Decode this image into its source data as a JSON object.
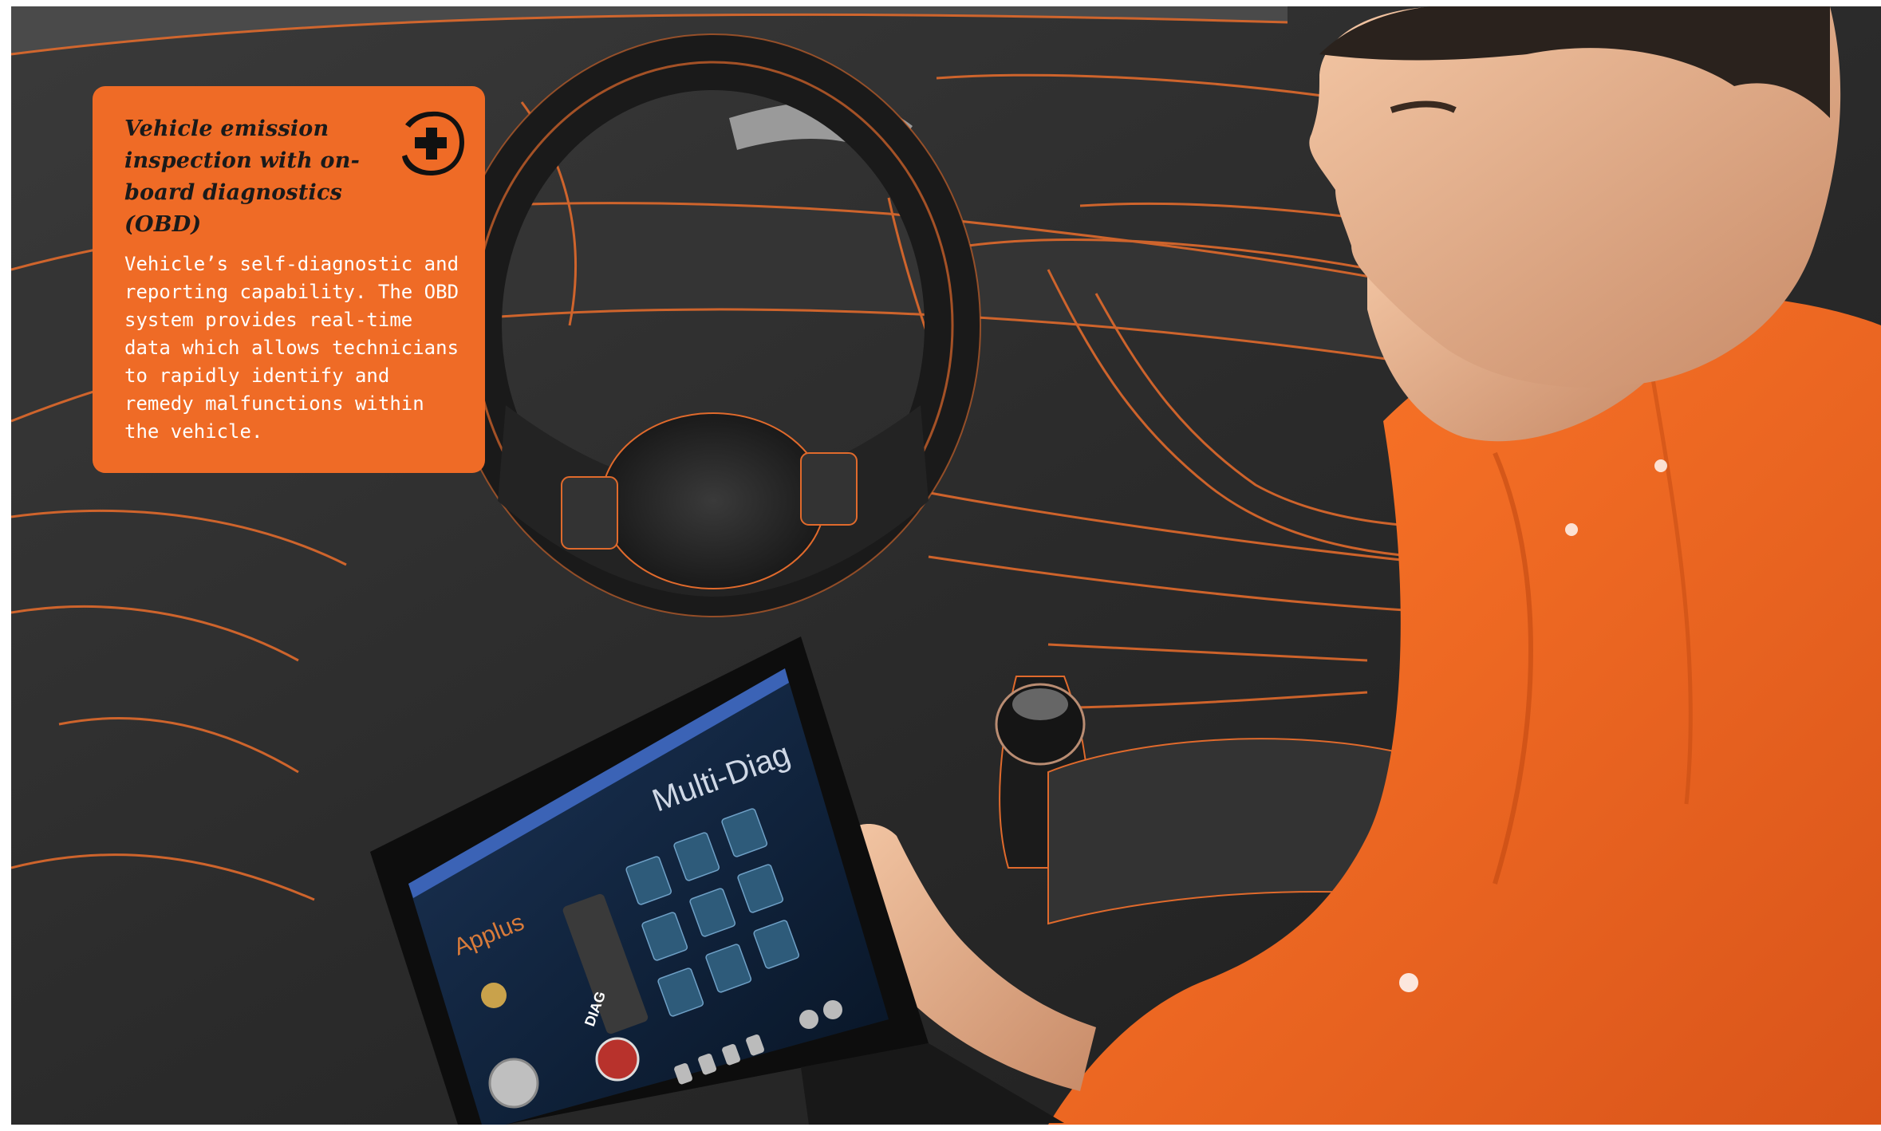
{
  "card": {
    "title": "Vehicle emission inspection with on-board diagnostics (OBD)",
    "body": "Vehicle’s self-diagnostic and reporting capability. The OBD system provides real-time data which allows technicians to rapidly identify and remedy malfunctions within the vehicle.",
    "icon": "plus-icon",
    "accent_color": "#ef6b26"
  },
  "tablet": {
    "brand": "Applus",
    "app_title": "Multi-Diag",
    "diag_label": "DIAG"
  },
  "colors": {
    "interior": "#2a2a2a",
    "outline": "#e06a2c",
    "shirt": "#f26a1e"
  }
}
